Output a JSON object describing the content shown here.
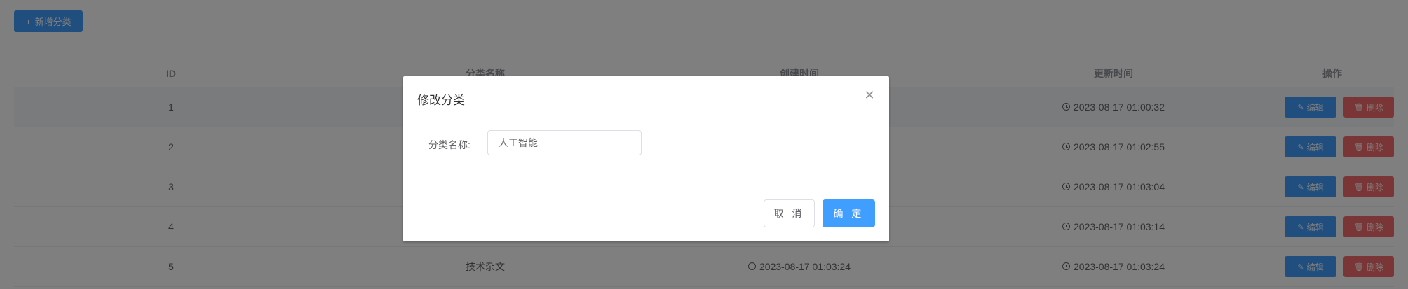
{
  "toolbar": {
    "add_label": "新增分类",
    "add_icon": "plus-icon"
  },
  "table": {
    "headers": {
      "id": "ID",
      "name": "分类名称",
      "created": "创建时间",
      "updated": "更新时间",
      "ops": "操作"
    },
    "rows": [
      {
        "id": "1",
        "name": "",
        "created": "",
        "updated": "2023-08-17 01:00:32"
      },
      {
        "id": "2",
        "name": "",
        "created": "",
        "updated": "2023-08-17 01:02:55"
      },
      {
        "id": "3",
        "name": "",
        "created": "",
        "updated": "2023-08-17 01:03:04"
      },
      {
        "id": "4",
        "name": "",
        "created": "",
        "updated": "2023-08-17 01:03:14"
      },
      {
        "id": "5",
        "name": "技术杂文",
        "created": "2023-08-17 01:03:24",
        "updated": "2023-08-17 01:03:24"
      }
    ],
    "edit_label": "编辑",
    "delete_label": "删除"
  },
  "dialog": {
    "title": "修改分类",
    "field_label": "分类名称:",
    "field_value": "人工智能",
    "cancel_label": "取 消",
    "ok_label": "确 定"
  },
  "colors": {
    "primary": "#409eff",
    "danger": "#f56c6c",
    "mask": "rgba(0,0,0,0.5)"
  }
}
